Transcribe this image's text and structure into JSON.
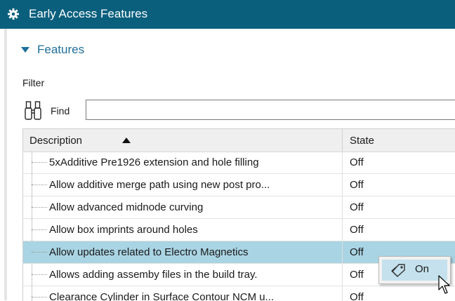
{
  "window": {
    "title": "Early Access Features",
    "icon": "gear-icon"
  },
  "section": {
    "label": "Features",
    "expanded": true
  },
  "filter": {
    "label": "Filter",
    "find_label": "Find",
    "find_value": ""
  },
  "table": {
    "columns": [
      {
        "label": "Description",
        "sort": "ascending"
      },
      {
        "label": "State"
      }
    ],
    "rows": [
      {
        "description": "5xAdditive Pre1926 extension and hole filling",
        "state": "Off"
      },
      {
        "description": "Allow additive merge path using new post pro...",
        "state": "Off"
      },
      {
        "description": "Allow advanced midnode curving",
        "state": "Off"
      },
      {
        "description": "Allow box imprints around holes",
        "state": "Off"
      },
      {
        "description": "Allow updates related to Electro Magnetics",
        "state": "Off",
        "selected": true
      },
      {
        "description": "Allows adding assemby files in the build tray.",
        "state": "Off"
      },
      {
        "description": "Clearance Cylinder in Surface Contour NCM u...",
        "state": "Off"
      }
    ]
  },
  "dropdown": {
    "option": "On",
    "icon": "tag-icon"
  },
  "colors": {
    "titlebar": "#0a5f7d",
    "selected_row": "#a9d4e3",
    "accent_text": "#1f6f9a"
  }
}
